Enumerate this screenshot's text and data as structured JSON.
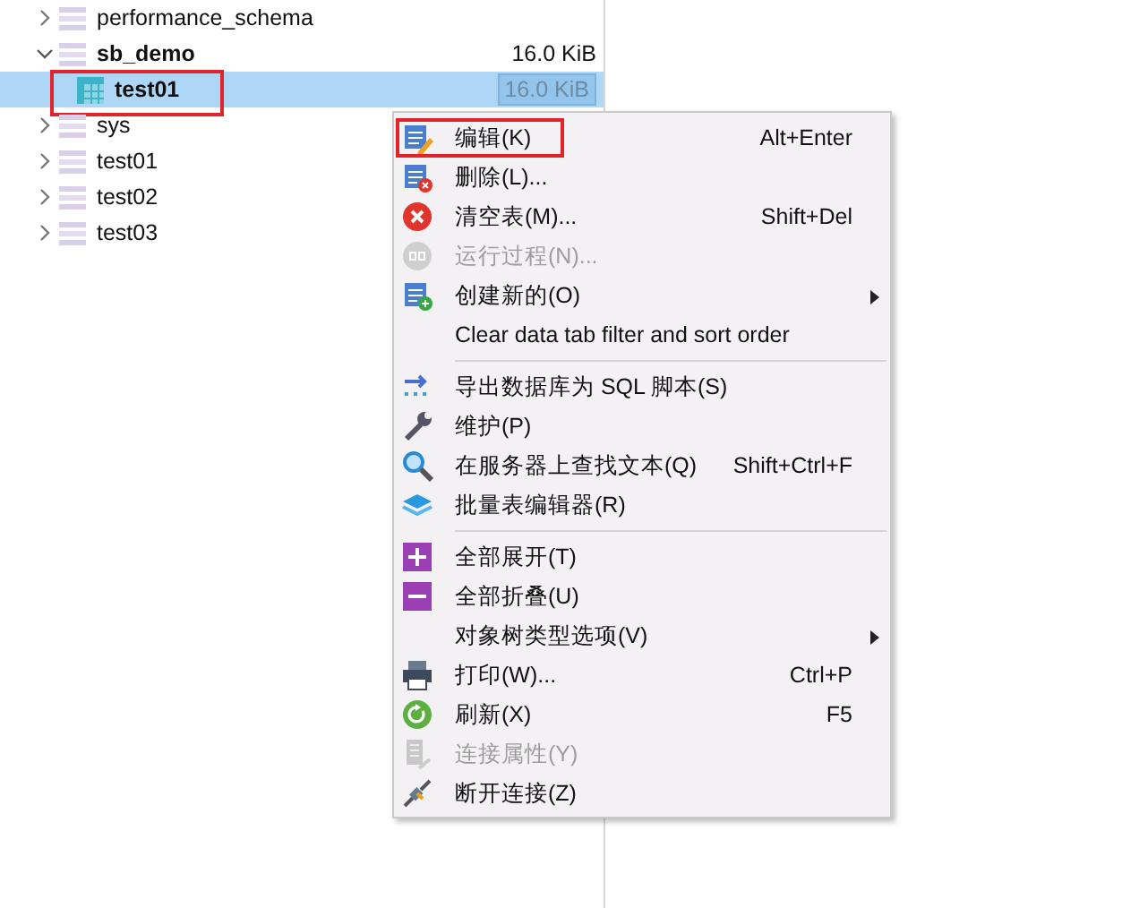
{
  "tree": [
    {
      "name": "performance_schema",
      "kind": "database",
      "expanded": false,
      "selected": false,
      "annotated": false,
      "bold": false
    },
    {
      "name": "sb_demo",
      "kind": "database",
      "expanded": true,
      "selected": false,
      "annotated": false,
      "bold": true,
      "size": "16.0 KiB",
      "children": [
        {
          "name": "test01",
          "kind": "table",
          "selected": true,
          "annotated": true,
          "bold": true,
          "size": "16.0 KiB"
        }
      ]
    },
    {
      "name": "sys",
      "kind": "database",
      "expanded": false,
      "selected": false,
      "annotated": false,
      "bold": false
    },
    {
      "name": "test01",
      "kind": "database",
      "expanded": false,
      "selected": false,
      "annotated": false,
      "bold": false
    },
    {
      "name": "test02",
      "kind": "database",
      "expanded": false,
      "selected": false,
      "annotated": false,
      "bold": false
    },
    {
      "name": "test03",
      "kind": "database",
      "expanded": false,
      "selected": false,
      "annotated": false,
      "bold": false
    }
  ],
  "context_menu": [
    {
      "kind": "edit",
      "label": "编辑(K)",
      "shortcut": "Alt+Enter",
      "disabled": false,
      "annotated": true
    },
    {
      "kind": "delete",
      "label": "删除(L)...",
      "disabled": false,
      "annotated": false
    },
    {
      "kind": "clear",
      "label": "清空表(M)...",
      "shortcut": "Shift+Del",
      "disabled": false,
      "annotated": false
    },
    {
      "kind": "run",
      "label": "运行过程(N)...",
      "disabled": true,
      "annotated": false
    },
    {
      "kind": "create",
      "label": "创建新的(O)",
      "submenu": true,
      "disabled": false,
      "annotated": false
    },
    {
      "kind": "plain",
      "label": "Clear data tab filter and sort order",
      "disabled": false,
      "annotated": false
    },
    {
      "kind": "separator"
    },
    {
      "kind": "export",
      "label": "导出数据库为 SQL 脚本(S)",
      "disabled": false,
      "annotated": false
    },
    {
      "kind": "wrench",
      "label": "维护(P)",
      "disabled": false,
      "annotated": false
    },
    {
      "kind": "search",
      "label": "在服务器上查找文本(Q)",
      "shortcut": "Shift+Ctrl+F",
      "disabled": false,
      "annotated": false
    },
    {
      "kind": "layers",
      "label": "批量表编辑器(R)",
      "disabled": false,
      "annotated": false
    },
    {
      "kind": "separator"
    },
    {
      "kind": "expand",
      "label": "全部展开(T)",
      "disabled": false,
      "annotated": false
    },
    {
      "kind": "collapse",
      "label": "全部折叠(U)",
      "disabled": false,
      "annotated": false
    },
    {
      "kind": "plain",
      "label": "对象树类型选项(V)",
      "submenu": true,
      "disabled": false,
      "annotated": false
    },
    {
      "kind": "print",
      "label": "打印(W)...",
      "shortcut": "Ctrl+P",
      "disabled": false,
      "annotated": false
    },
    {
      "kind": "refresh",
      "label": "刷新(X)",
      "shortcut": "F5",
      "disabled": false,
      "annotated": false
    },
    {
      "kind": "properties",
      "label": "连接属性(Y)",
      "disabled": true,
      "annotated": false
    },
    {
      "kind": "disconnect",
      "label": "断开连接(Z)",
      "disabled": false,
      "annotated": false
    }
  ]
}
